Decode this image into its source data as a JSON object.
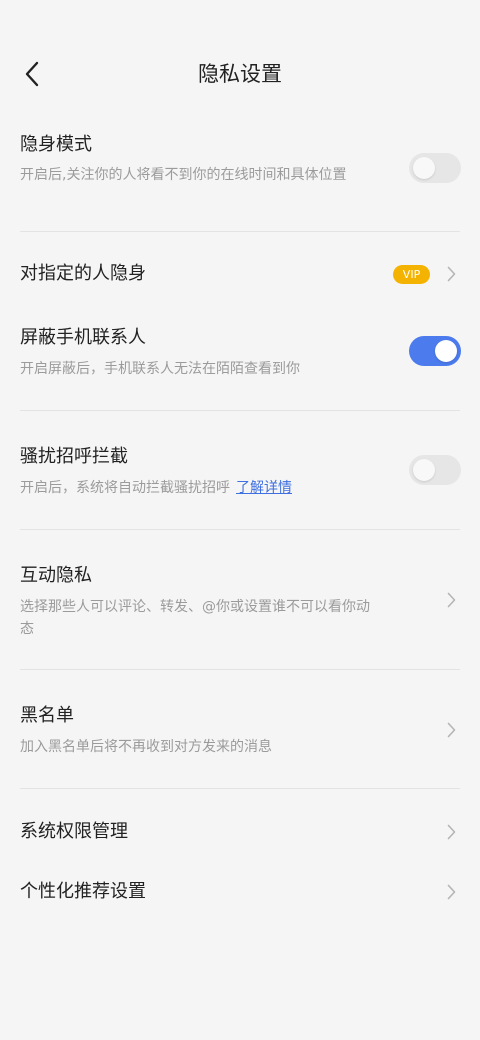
{
  "header": {
    "title": "隐私设置"
  },
  "settings": {
    "stealth_mode": {
      "title": "隐身模式",
      "desc": "开启后,关注你的人将看不到你的在线时间和具体位置",
      "enabled": false
    },
    "hide_from_specific": {
      "title": "对指定的人隐身",
      "badge": "VIP"
    },
    "block_contacts": {
      "title": "屏蔽手机联系人",
      "desc": "开启屏蔽后，手机联系人无法在陌陌查看到你",
      "enabled": true
    },
    "harassment_block": {
      "title": "骚扰招呼拦截",
      "desc": "开启后，系统将自动拦截骚扰招呼",
      "link": "了解详情",
      "enabled": false
    },
    "interaction_privacy": {
      "title": "互动隐私",
      "desc": "选择那些人可以评论、转发、@你或设置谁不可以看你动态"
    },
    "blacklist": {
      "title": "黑名单",
      "desc": "加入黑名单后将不再收到对方发来的消息"
    },
    "system_permissions": {
      "title": "系统权限管理"
    },
    "personalized_recommendation": {
      "title": "个性化推荐设置"
    }
  },
  "colors": {
    "toggle_on": "#4b7bec",
    "toggle_off": "#e6e6e6",
    "vip": "#f5b301",
    "link": "#3f6fe0"
  }
}
